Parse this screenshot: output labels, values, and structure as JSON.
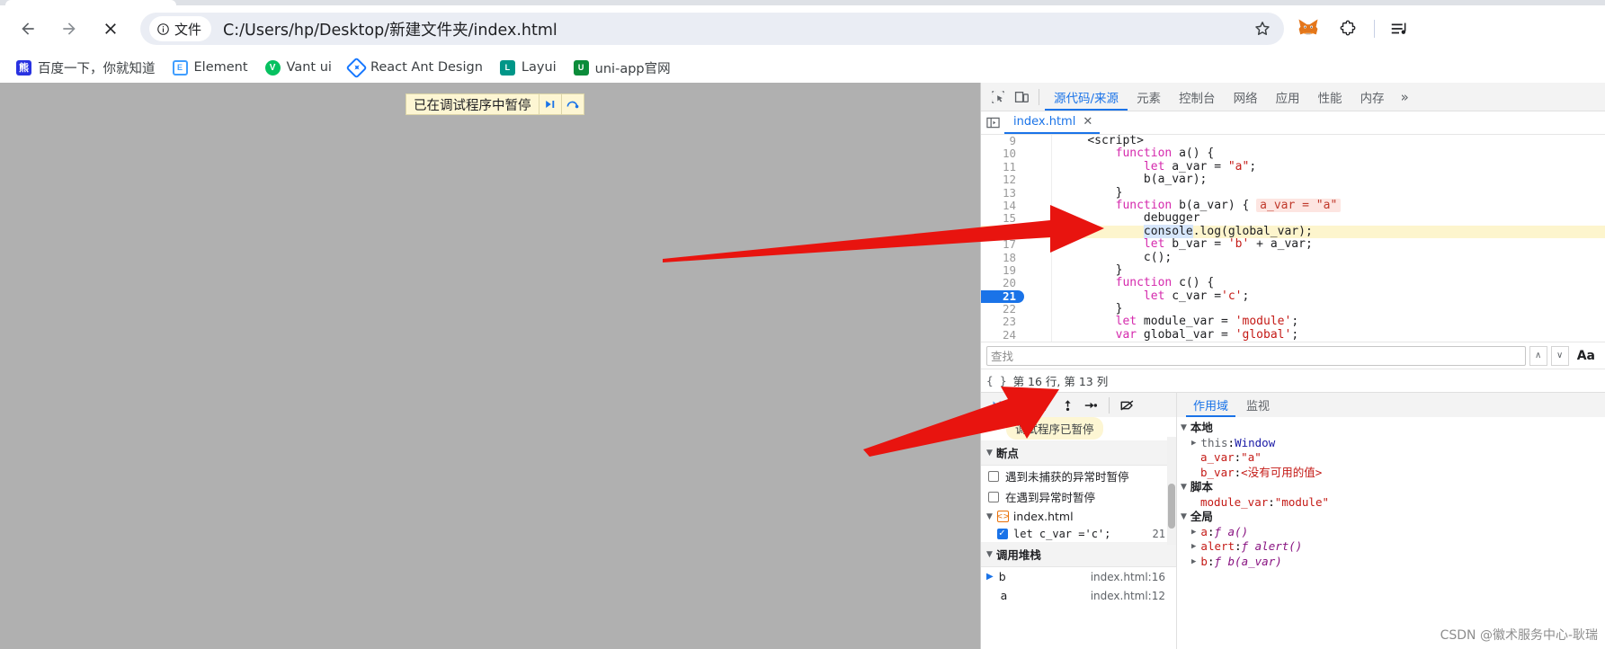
{
  "browser": {
    "nav": {
      "back": "←",
      "forward": "→",
      "stop": "✕"
    },
    "omnibox": {
      "file_badge_label": "文件",
      "url": "C:/Users/hp/Desktop/新建文件夹/index.html",
      "star_title": "收藏"
    },
    "extensions": [
      {
        "name": "metamask-extension-icon"
      },
      {
        "name": "extensions-puzzle-icon"
      },
      {
        "name": "reading-list-icon"
      }
    ],
    "bookmarks": [
      {
        "label": "百度一下，你就知道",
        "icon": "baidu-icon",
        "color": "#2932e1"
      },
      {
        "label": "Element",
        "icon": "element-icon",
        "color": "#409eff"
      },
      {
        "label": "Vant ui",
        "icon": "vant-icon",
        "color": "#07c160"
      },
      {
        "label": "React Ant Design",
        "icon": "react-ant-design-icon",
        "color": "#1677ff"
      },
      {
        "label": "Layui",
        "icon": "layui-icon",
        "color": "#009688"
      },
      {
        "label": "uni-app官网",
        "icon": "uniapp-icon",
        "color": "#0b8c3a"
      }
    ]
  },
  "page": {
    "paused_banner": {
      "text": "已在调试程序中暂停",
      "resume_icon": "resume-script-icon",
      "step_icon": "step-over-icon"
    }
  },
  "devtools": {
    "toolbar_icons": [
      {
        "name": "inspect-element-icon"
      },
      {
        "name": "device-toolbar-icon"
      }
    ],
    "tabs": [
      {
        "label": "源代码/来源",
        "active": true
      },
      {
        "label": "元素",
        "active": false
      },
      {
        "label": "控制台",
        "active": false
      },
      {
        "label": "网络",
        "active": false
      },
      {
        "label": "应用",
        "active": false
      },
      {
        "label": "性能",
        "active": false
      },
      {
        "label": "内存",
        "active": false
      }
    ],
    "more_tabs_label": "»",
    "file_tab": {
      "label": "index.html",
      "close": "✕",
      "panel_icon": "show-navigator-icon"
    },
    "editor": {
      "lines": [
        {
          "num": "9",
          "highlight": false,
          "breakpoint": false,
          "tokens": [
            {
              "t": "    ",
              "c": "plain"
            },
            {
              "t": "<script>",
              "c": "plain"
            }
          ]
        },
        {
          "num": "10",
          "highlight": false,
          "breakpoint": false,
          "tokens": [
            {
              "t": "        ",
              "c": "plain"
            },
            {
              "t": "function",
              "c": "kw"
            },
            {
              "t": " a() {",
              "c": "plain"
            }
          ]
        },
        {
          "num": "11",
          "highlight": false,
          "breakpoint": false,
          "tokens": [
            {
              "t": "            ",
              "c": "plain"
            },
            {
              "t": "let",
              "c": "kw"
            },
            {
              "t": " a_var = ",
              "c": "plain"
            },
            {
              "t": "\"a\"",
              "c": "str"
            },
            {
              "t": ";",
              "c": "plain"
            }
          ]
        },
        {
          "num": "12",
          "highlight": false,
          "breakpoint": false,
          "tokens": [
            {
              "t": "            b(a_var);",
              "c": "plain"
            }
          ]
        },
        {
          "num": "13",
          "highlight": false,
          "breakpoint": false,
          "tokens": [
            {
              "t": "        }",
              "c": "plain"
            }
          ]
        },
        {
          "num": "14",
          "highlight": false,
          "breakpoint": false,
          "tokens": [
            {
              "t": "        ",
              "c": "plain"
            },
            {
              "t": "function",
              "c": "kw"
            },
            {
              "t": " b(a_var) { ",
              "c": "plain"
            },
            {
              "t": "a_var = \"a\"",
              "c": "inlinehint"
            }
          ]
        },
        {
          "num": "15",
          "highlight": false,
          "breakpoint": false,
          "tokens": [
            {
              "t": "            ",
              "c": "plain"
            },
            {
              "t": "debugger",
              "c": "plain"
            }
          ]
        },
        {
          "num": "16",
          "highlight": true,
          "breakpoint": false,
          "tokens": [
            {
              "t": "            ",
              "c": "plain"
            },
            {
              "t": "console",
              "c": "console-hl"
            },
            {
              "t": ".log(global_var);",
              "c": "plain"
            }
          ]
        },
        {
          "num": "17",
          "highlight": false,
          "breakpoint": false,
          "tokens": [
            {
              "t": "            ",
              "c": "plain"
            },
            {
              "t": "let",
              "c": "kw"
            },
            {
              "t": " b_var = ",
              "c": "plain"
            },
            {
              "t": "'b'",
              "c": "str"
            },
            {
              "t": " + a_var;",
              "c": "plain"
            }
          ]
        },
        {
          "num": "18",
          "highlight": false,
          "breakpoint": false,
          "tokens": [
            {
              "t": "            c();",
              "c": "plain"
            }
          ]
        },
        {
          "num": "19",
          "highlight": false,
          "breakpoint": false,
          "tokens": [
            {
              "t": "        }",
              "c": "plain"
            }
          ]
        },
        {
          "num": "20",
          "highlight": false,
          "breakpoint": false,
          "tokens": [
            {
              "t": "        ",
              "c": "plain"
            },
            {
              "t": "function",
              "c": "kw"
            },
            {
              "t": " c() {",
              "c": "plain"
            }
          ]
        },
        {
          "num": "21",
          "highlight": false,
          "breakpoint": true,
          "tokens": [
            {
              "t": "            ",
              "c": "plain"
            },
            {
              "t": "let",
              "c": "kw"
            },
            {
              "t": " c_var =",
              "c": "plain"
            },
            {
              "t": "'c'",
              "c": "str"
            },
            {
              "t": ";",
              "c": "plain"
            }
          ]
        },
        {
          "num": "22",
          "highlight": false,
          "breakpoint": false,
          "tokens": [
            {
              "t": "        }",
              "c": "plain"
            }
          ]
        },
        {
          "num": "23",
          "highlight": false,
          "breakpoint": false,
          "tokens": [
            {
              "t": "        ",
              "c": "plain"
            },
            {
              "t": "let",
              "c": "kw"
            },
            {
              "t": " module_var = ",
              "c": "plain"
            },
            {
              "t": "'module'",
              "c": "str"
            },
            {
              "t": ";",
              "c": "plain"
            }
          ]
        },
        {
          "num": "24",
          "highlight": false,
          "breakpoint": false,
          "tokens": [
            {
              "t": "        ",
              "c": "plain"
            },
            {
              "t": "var",
              "c": "kw"
            },
            {
              "t": " global_var = ",
              "c": "plain"
            },
            {
              "t": "'global'",
              "c": "str"
            },
            {
              "t": ";",
              "c": "plain"
            }
          ]
        }
      ]
    },
    "search": {
      "placeholder": "查找",
      "prev_label": "∧",
      "next_label": "∨",
      "match_case_label": "Aa"
    },
    "status": {
      "brace": "{ }",
      "position": "第 16 行, 第 13 列"
    },
    "debug_controls": [
      {
        "name": "resume-script-button",
        "title": "继续执行脚本"
      },
      {
        "name": "step-over-button",
        "title": "跨过下一个函数调用"
      },
      {
        "name": "step-into-button",
        "title": "单步调试进入下一个函数调用"
      },
      {
        "name": "step-out-button",
        "title": "单步调试跳出当前函数"
      },
      {
        "name": "step-button",
        "title": "单步调试"
      },
      {
        "name": "deactivate-breakpoints-button",
        "title": "停用断点"
      }
    ],
    "paused_tooltip": "调试程序已暂停",
    "side_tabs": [
      {
        "label": "作用域",
        "active": true
      },
      {
        "label": "监视",
        "active": false
      }
    ],
    "breakpoints_panel": {
      "title": "断点",
      "options": [
        {
          "label": "遇到未捕获的异常时暂停",
          "checked": false
        },
        {
          "label": "在遇到异常时暂停",
          "checked": false
        }
      ],
      "file": {
        "name": "index.html",
        "icon": "html-file-icon"
      },
      "items": [
        {
          "code": "let c_var ='c';",
          "line": "21",
          "checked": true
        }
      ]
    },
    "call_stack_panel": {
      "title": "调用堆栈",
      "frames": [
        {
          "name": "b",
          "location": "index.html:16",
          "current": true
        },
        {
          "name": "a",
          "location": "index.html:12",
          "current": false
        }
      ]
    },
    "scope_panel": {
      "groups": [
        {
          "title": "本地",
          "expanded": true,
          "entries": [
            {
              "expandable": true,
              "key": "this",
              "sep": ": ",
              "value": "Window",
              "vclass": "sval"
            },
            {
              "expandable": false,
              "key": "a_var",
              "sep": ": ",
              "value": "\"a\"",
              "vclass": "sval str"
            },
            {
              "expandable": false,
              "key": "b_var",
              "sep": ": ",
              "value": "<没有可用的值>",
              "vclass": "sval gray"
            }
          ]
        },
        {
          "title": "脚本",
          "expanded": true,
          "entries": [
            {
              "expandable": false,
              "key": "module_var",
              "sep": ": ",
              "value": "\"module\"",
              "vclass": "sval str"
            }
          ]
        },
        {
          "title": "全局",
          "expanded": true,
          "entries": [
            {
              "expandable": true,
              "key": "a",
              "sep": ": ",
              "value": "ƒ a()",
              "vclass": "sval fn"
            },
            {
              "expandable": true,
              "key": "alert",
              "sep": ": ",
              "value": "ƒ alert()",
              "vclass": "sval fn"
            },
            {
              "expandable": true,
              "key": "b",
              "sep": ": ",
              "value": "ƒ b(a_var)",
              "vclass": "sval fn"
            }
          ]
        }
      ]
    }
  },
  "annotations": {
    "arrow_color": "#e8140f",
    "arrows": [
      {
        "name": "arrow-to-paused-line"
      },
      {
        "name": "arrow-to-debug-controls"
      }
    ]
  },
  "watermark": "CSDN @徽术服务中心-耿瑞"
}
